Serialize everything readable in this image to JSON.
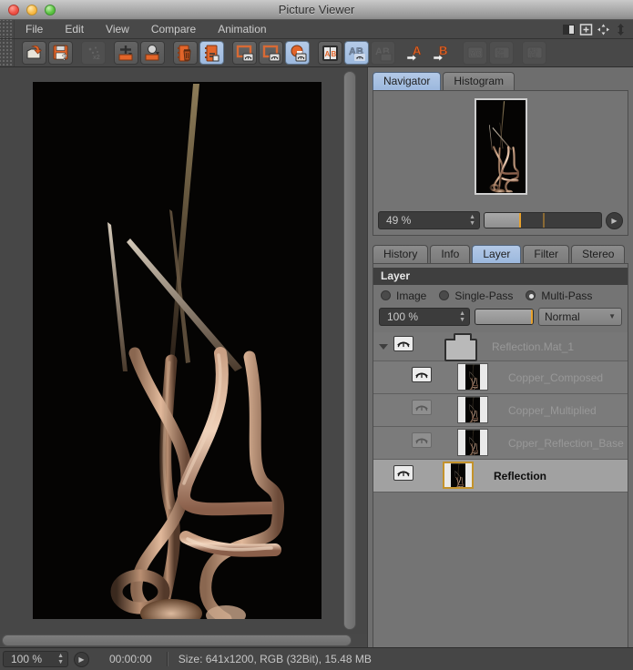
{
  "window": {
    "title": "Picture Viewer"
  },
  "menubar": {
    "items": [
      "File",
      "Edit",
      "View",
      "Compare",
      "Animation"
    ],
    "right_icons": [
      "split-view-icon",
      "add-panel-icon",
      "move-icon",
      "resize-vertical-icon"
    ]
  },
  "toolbar": {
    "ab_a_label": "A",
    "ab_b_label": "B",
    "icons": [
      "open-image",
      "save-image",
      "render-disabled",
      "import-cross",
      "import-person",
      "delete-image",
      "filmstrip-selected",
      "frame-a-eye",
      "frame-b-eye",
      "rgb-eye-selected",
      "ab-swatch",
      "ab-eye-selected",
      "ab-disabled",
      "set-a",
      "set-b",
      "compare-ad-disabled",
      "compare-grid-disabled",
      "compare-seq-disabled"
    ]
  },
  "navigator": {
    "tabs": [
      "Navigator",
      "Histogram"
    ],
    "active_tab": "Navigator",
    "zoom_value": "49 %",
    "slider_fill_pct": 30
  },
  "panel": {
    "tabs": [
      "History",
      "Info",
      "Layer",
      "Filter",
      "Stereo"
    ],
    "active_tab": "Layer",
    "section_title": "Layer",
    "modes": [
      {
        "label": "Image",
        "selected": false
      },
      {
        "label": "Single-Pass",
        "selected": false
      },
      {
        "label": "Multi-Pass",
        "selected": true
      }
    ],
    "opacity_value": "100 %",
    "blend_mode": "Normal",
    "layers": [
      {
        "name": "Reflection.Mat_1",
        "type": "folder",
        "visible": true,
        "selected": false
      },
      {
        "name": "Copper_Composed",
        "type": "layer",
        "visible": true,
        "selected": false
      },
      {
        "name": "Copper_Multiplied",
        "type": "layer",
        "visible": false,
        "selected": false
      },
      {
        "name": "Cpper_Reflection_Base",
        "type": "layer",
        "visible": false,
        "selected": false
      },
      {
        "name": "Reflection",
        "type": "layer",
        "visible": true,
        "selected": true
      }
    ]
  },
  "statusbar": {
    "zoom_value": "100 %",
    "timecode": "00:00:00",
    "info": "Size: 641x1200, RGB (32Bit), 15.48 MB"
  },
  "colors": {
    "accent_orange": "#e2652a",
    "selection_blue": "#a6c1e2",
    "gold_border": "#c3922b",
    "canvas_black": "#050403"
  }
}
